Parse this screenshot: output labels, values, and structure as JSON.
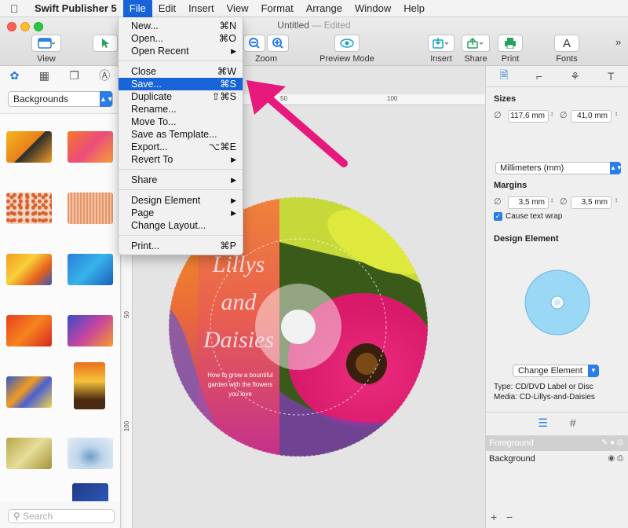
{
  "menubar": {
    "app_name": "Swift Publisher 5",
    "items": [
      "File",
      "Edit",
      "Insert",
      "View",
      "Format",
      "Arrange",
      "Window",
      "Help"
    ]
  },
  "window": {
    "title": "Untitled",
    "title_suffix": "— Edited"
  },
  "toolbar": {
    "view_label": "View",
    "zoom_label": "Zoom",
    "preview_label": "Preview Mode",
    "insert_label": "Insert",
    "share_label": "Share",
    "print_label": "Print",
    "fonts_label": "Fonts"
  },
  "file_menu": {
    "items": [
      {
        "label": "New...",
        "shortcut": "⌘N"
      },
      {
        "label": "Open...",
        "shortcut": "⌘O"
      },
      {
        "label": "Open Recent",
        "shortcut": "▶"
      },
      {
        "label": "Close",
        "shortcut": "⌘W"
      },
      {
        "label": "Save...",
        "shortcut": "⌘S"
      },
      {
        "label": "Duplicate",
        "shortcut": "⇧⌘S"
      },
      {
        "label": "Rename...",
        "shortcut": ""
      },
      {
        "label": "Move To...",
        "shortcut": ""
      },
      {
        "label": "Save as Template...",
        "shortcut": ""
      },
      {
        "label": "Export...",
        "shortcut": "⌥⌘E"
      },
      {
        "label": "Revert To",
        "shortcut": "▶"
      },
      {
        "label": "Share",
        "shortcut": "▶"
      },
      {
        "label": "Design Element",
        "shortcut": "▶"
      },
      {
        "label": "Page",
        "shortcut": "▶"
      },
      {
        "label": "Change Layout...",
        "shortcut": ""
      },
      {
        "label": "Print...",
        "shortcut": "⌘P"
      }
    ],
    "highlighted": "Save..."
  },
  "left_panel": {
    "category": "Backgrounds",
    "search_placeholder": "Search"
  },
  "rulers": {
    "h_ticks": [
      "50",
      "100"
    ],
    "v_ticks": [
      "50",
      "100"
    ]
  },
  "cd_label": {
    "title_line1": "Lillys",
    "title_line2": "and",
    "title_line3": "Daisies",
    "subtitle": "How to grow a bountiful garden with the flowers you love"
  },
  "right_panel": {
    "sizes_heading": "Sizes",
    "width_value": "117,6 mm",
    "height_value": "41,0 mm",
    "units": "Millimeters (mm)",
    "margins_heading": "Margins",
    "margin_left": "3,5 mm",
    "margin_right": "3,5 mm",
    "cause_text_wrap": "Cause text wrap",
    "design_element_heading": "Design Element",
    "change_element": "Change Element",
    "type_text": "Type: CD/DVD Label or Disc",
    "media_text": "Media: CD-Lillys-and-Daisies",
    "layers": [
      "Foreground",
      "Background"
    ]
  },
  "colors": {
    "accent": "#1764d9",
    "arrow": "#e8197d",
    "cd_preview": "#9ad8f5"
  }
}
